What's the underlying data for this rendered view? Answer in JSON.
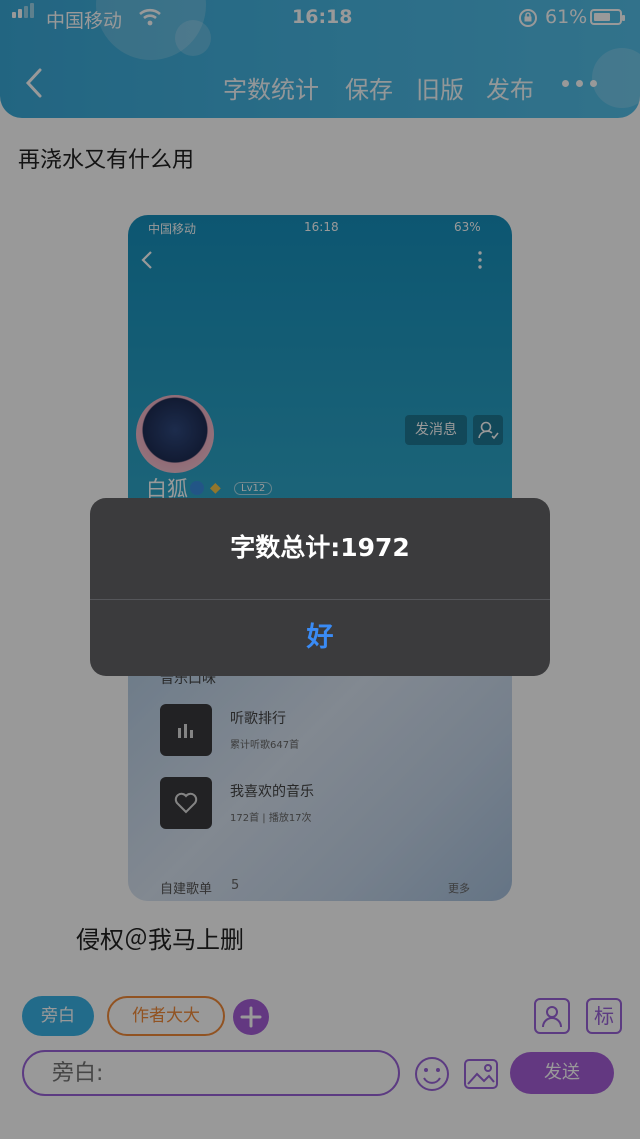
{
  "status_bar": {
    "carrier": "中国移动",
    "time": "16:18",
    "battery_percent": "61%",
    "signal_icon": "signal-icon",
    "wifi_icon": "wifi-icon",
    "rotation_lock_icon": "rotation-lock-icon",
    "battery_icon": "battery-icon"
  },
  "header": {
    "back_icon": "chevron-left-icon",
    "word_count_label": "字数统计",
    "save_label": "保存",
    "old_version_label": "旧版",
    "publish_label": "发布",
    "more_icon": "more-horizontal-icon",
    "accent_color": "#47b6e2"
  },
  "content": {
    "title_text": "再浇水又有什么用",
    "embedded_screenshot": {
      "carrier": "中国移动",
      "time": "16:18",
      "battery_percent": "63%",
      "user_name": "白狐",
      "level_badge": "Lv12",
      "send_message_label": "发消息",
      "music_section_label": "音乐口味",
      "items": [
        {
          "title": "听歌排行",
          "subtitle": "累计听歌647首",
          "icon": "bar-chart-icon"
        },
        {
          "title": "我喜欢的音乐",
          "subtitle": "172首 | 播放17次",
          "icon": "heart-icon"
        }
      ],
      "playlist_label": "自建歌单",
      "playlist_count": "5",
      "more_label": "更多"
    },
    "footer_text": "侵权＠我马上删"
  },
  "bottom_bar": {
    "narrator_tag": "旁白",
    "author_tag": "作者大大",
    "add_icon": "plus-circle-icon",
    "user_icon": "user-card-icon",
    "mark_label": "标",
    "input_placeholder": "旁白:",
    "emoji_icon": "emoji-icon",
    "image_icon": "image-icon",
    "send_label": "发送",
    "accent_color": "#a55ed8"
  },
  "alert": {
    "message": "字数总计:1972",
    "ok_label": "好",
    "ok_color": "#3a8bf5"
  }
}
